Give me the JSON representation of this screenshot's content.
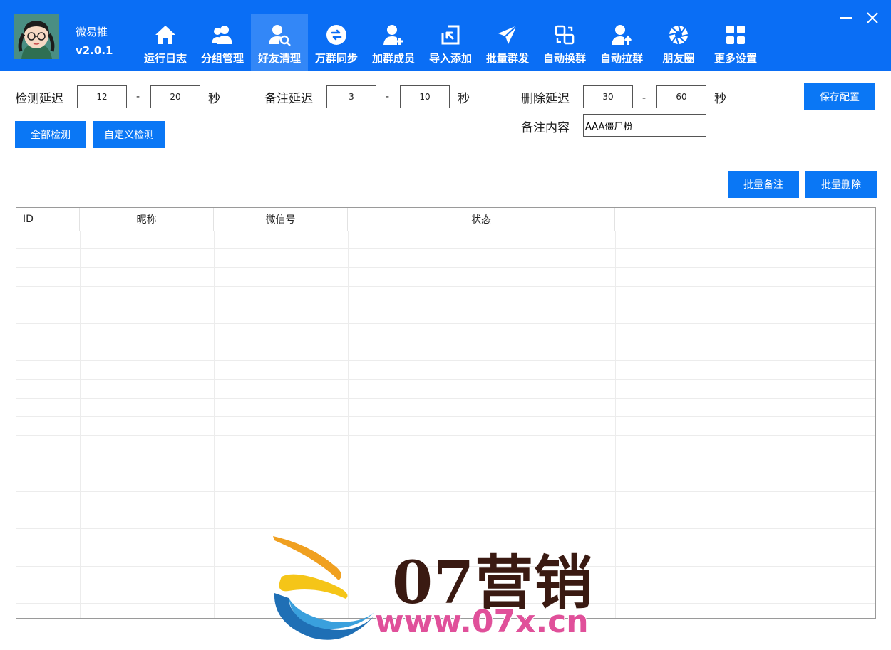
{
  "app": {
    "name": "微易推",
    "version": "v2.0.1"
  },
  "nav": {
    "items": [
      {
        "label": "运行日志",
        "icon": "home-icon"
      },
      {
        "label": "分组管理",
        "icon": "users-icon"
      },
      {
        "label": "好友清理",
        "icon": "user-search-icon",
        "active": true
      },
      {
        "label": "万群同步",
        "icon": "sync-icon"
      },
      {
        "label": "加群成员",
        "icon": "user-add-icon"
      },
      {
        "label": "导入添加",
        "icon": "import-icon"
      },
      {
        "label": "批量群发",
        "icon": "send-icon"
      },
      {
        "label": "自动换群",
        "icon": "swap-icon"
      },
      {
        "label": "自动拉群",
        "icon": "user-up-icon"
      },
      {
        "label": "朋友圈",
        "icon": "aperture-icon"
      },
      {
        "label": "更多设置",
        "icon": "grid-icon"
      }
    ]
  },
  "window": {
    "minimize_icon": "minimize-icon",
    "close_icon": "close-icon"
  },
  "config": {
    "check_delay": {
      "label": "检测延迟",
      "min": "12",
      "max": "20",
      "unit": "秒"
    },
    "remark_delay": {
      "label": "备注延迟",
      "min": "3",
      "max": "10",
      "unit": "秒"
    },
    "delete_delay": {
      "label": "删除延迟",
      "min": "30",
      "max": "60",
      "unit": "秒"
    },
    "dash": "-",
    "remark_content": {
      "label": "备注内容",
      "value": "AAA僵尸粉"
    },
    "save_label": "保存配置",
    "check_all_label": "全部检测",
    "custom_check_label": "自定义检测",
    "batch_remark_label": "批量备注",
    "batch_delete_label": "批量删除"
  },
  "table": {
    "columns": [
      "ID",
      "昵称",
      "微信号",
      "状态"
    ],
    "rows": []
  },
  "watermark": {
    "brand": "07营销",
    "url": "www.07x.cn"
  },
  "colors": {
    "header": "#0a6ef5",
    "active_tab": "#3387f7",
    "button": "#0a77f5"
  }
}
